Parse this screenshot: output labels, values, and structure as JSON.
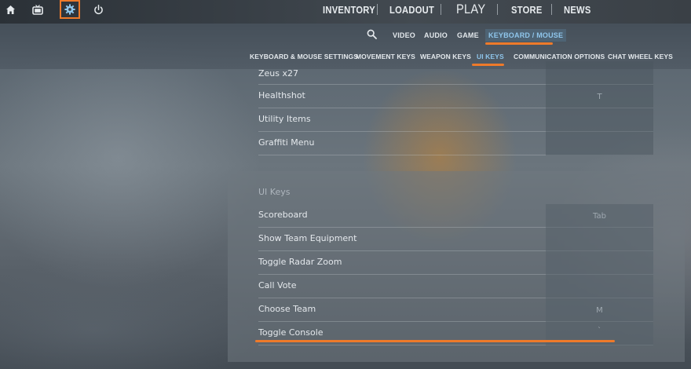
{
  "topbar": {
    "icons": [
      {
        "name": "home-icon",
        "active": false
      },
      {
        "name": "tv-icon",
        "active": false
      },
      {
        "name": "gear-icon",
        "active": true
      },
      {
        "name": "power-icon",
        "active": false
      }
    ],
    "nav": {
      "inventory": "INVENTORY",
      "loadout": "LOADOUT",
      "play": "PLAY",
      "store": "STORE",
      "news": "NEWS"
    }
  },
  "settings": {
    "categories": {
      "video": "VIDEO",
      "audio": "AUDIO",
      "game": "GAME",
      "keyboard_mouse": "KEYBOARD / MOUSE"
    },
    "active_category": "KEYBOARD / MOUSE",
    "subtabs": {
      "kb_settings": "KEYBOARD & MOUSE SETTINGS",
      "movement": "MOVEMENT KEYS",
      "weapon": "WEAPON KEYS",
      "ui": "UI KEYS",
      "communication": "COMMUNICATION OPTIONS",
      "chat_wheel": "CHAT WHEEL KEYS"
    },
    "active_subtab": "UI KEYS"
  },
  "upper_list": [
    {
      "label": "Zeus x27",
      "key": ""
    },
    {
      "label": "Healthshot",
      "key": "T"
    },
    {
      "label": "Utility Items",
      "key": ""
    },
    {
      "label": "Graffiti Menu",
      "key": ""
    }
  ],
  "ui_keys": {
    "title": "UI Keys",
    "rows": [
      {
        "label": "Scoreboard",
        "key": "Tab"
      },
      {
        "label": "Show Team Equipment",
        "key": ""
      },
      {
        "label": "Toggle Radar Zoom",
        "key": ""
      },
      {
        "label": "Call Vote",
        "key": ""
      },
      {
        "label": "Choose Team",
        "key": "M"
      },
      {
        "label": "Toggle Console",
        "key": "`"
      }
    ]
  },
  "colors": {
    "accent": "#ee7a2a",
    "active_text": "#8fc6ec"
  }
}
